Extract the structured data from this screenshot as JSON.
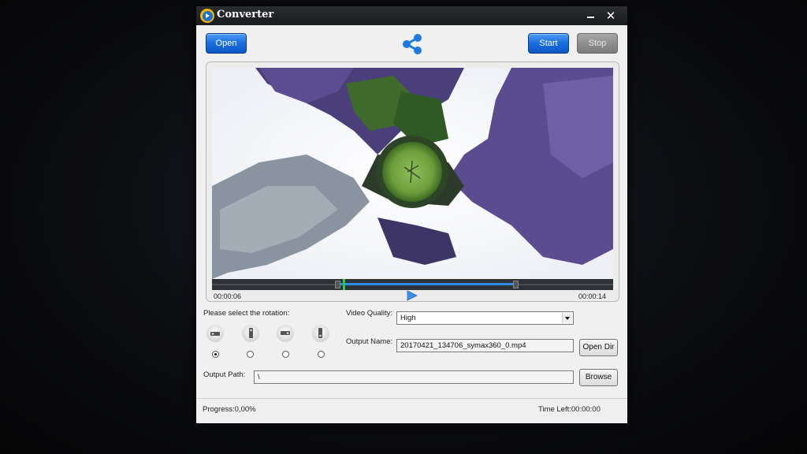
{
  "window": {
    "title": "Converter"
  },
  "toolbar": {
    "open_label": "Open",
    "start_label": "Start",
    "stop_label": "Stop"
  },
  "player": {
    "time_current": "00:00:06",
    "time_total": "00:00:14"
  },
  "rotation": {
    "label": "Please select the rotation:",
    "selected_index": 0
  },
  "quality": {
    "label": "Video Quality:",
    "value": "High"
  },
  "output_name": {
    "label": "Output Name:",
    "value": "20170421_134706_symax360_0.mp4",
    "open_dir_label": "Open Dir"
  },
  "output_path": {
    "label": "Output Path:",
    "value": "\\",
    "browse_label": "Browse"
  },
  "status": {
    "progress": "Progress:0,00%",
    "time_left": "Time Left:00:00:00"
  },
  "colors": {
    "accent": "#1a6ee0",
    "titlebar": "#1e1f22",
    "seek_range": "#2f8ee8",
    "seek_cursor": "#22cc44"
  }
}
